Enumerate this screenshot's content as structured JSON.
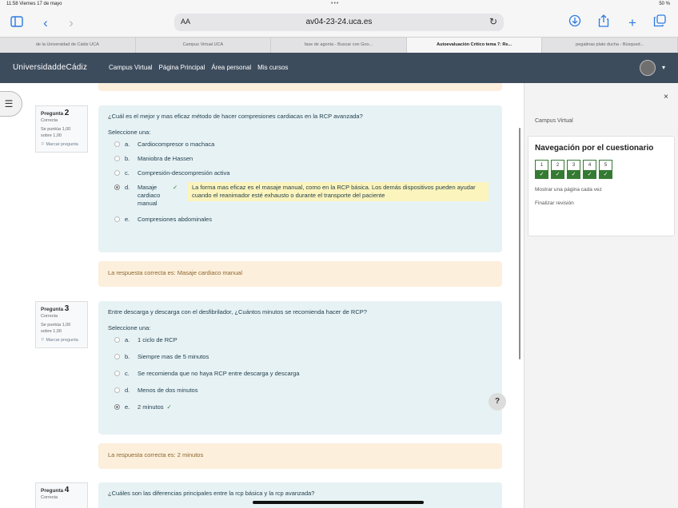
{
  "status_bar": {
    "time": "11:58  Viernes 17 de mayo",
    "dots": "•••",
    "battery": "50 %"
  },
  "browser": {
    "aa": "AA",
    "url": "av04-23-24.uca.es",
    "tabs": [
      {
        "label": "de la Universidad de Cádiz UCA",
        "active": false
      },
      {
        "label": "Campus Virtual UCA",
        "active": false
      },
      {
        "label": "fase de agonía - Buscar con Goo...",
        "active": false
      },
      {
        "label": "Autoevaluación Crítico tema 7: Re...",
        "active": true
      },
      {
        "label": "pegatinas plato ducha - Búsqued...",
        "active": false
      }
    ]
  },
  "site": {
    "brand": "UniversidaddeCádiz",
    "nav": [
      "Campus Virtual",
      "Página Principal",
      "Área personal",
      "Mis cursos"
    ]
  },
  "questions": [
    {
      "label": "Pregunta",
      "number": "2",
      "state": "Correcta",
      "score": "Se puntúa 1,00 sobre 1,00",
      "flag": "Marcar pregunta",
      "text": "¿Cuál es el mejor y mas eficaz método de hacer compresiones cardiacas en la RCP avanzada?",
      "select": "Seleccione una:",
      "options": [
        {
          "letter": "a.",
          "text": "Cardiocompresor o machaca"
        },
        {
          "letter": "b.",
          "text": "Maniobra de Hassen"
        },
        {
          "letter": "c.",
          "text": "Compresión-descompresión activa"
        },
        {
          "letter": "d.",
          "text": "Masaje cardiaco manual",
          "selected": true,
          "check": "✓",
          "feedback": "La forma mas eficaz es el masaje manual, como en la RCP básica. Los demás dispositivos pueden ayudar cuando el reanimador esté exhausto o durante el transporte del paciente"
        },
        {
          "letter": "e.",
          "text": "Compresiones abdominales"
        }
      ],
      "right_answer": "La respuesta correcta es: Masaje cardiaco manual"
    },
    {
      "label": "Pregunta",
      "number": "3",
      "state": "Correcta",
      "score": "Se puntúa 1,00 sobre 1,00",
      "flag": "Marcar pregunta",
      "text": "Entre descarga y descarga con el desfibrilador, ¿Cuántos minutos se recomienda hacer de RCP?",
      "select": "Seleccione una:",
      "options": [
        {
          "letter": "a.",
          "text": "1 ciclo de RCP"
        },
        {
          "letter": "b.",
          "text": "Siempre mas de 5 minutos"
        },
        {
          "letter": "c.",
          "text": "Se recomienda que no haya RCP entre descarga y descarga"
        },
        {
          "letter": "d.",
          "text": "Menos de dos minutos"
        },
        {
          "letter": "e.",
          "text": "2 minutos",
          "selected": true,
          "check": "✓"
        }
      ],
      "right_answer": "La respuesta correcta es: 2 minutos"
    },
    {
      "label": "Pregunta",
      "number": "4",
      "state": "Correcta",
      "text": "¿Cuáles son las diferencias principales entre la rcp básica y la rcp avanzada?"
    }
  ],
  "drawer": {
    "close": "×",
    "breadcrumb": "Campus Virtual",
    "title": "Navegación por el cuestionario",
    "quiz_nav": [
      "1",
      "2",
      "3",
      "4",
      "5"
    ],
    "check": "✓",
    "links": [
      "Mostrar una página cada vez",
      "Finalizar revisión"
    ]
  },
  "help": "?",
  "icons": [
    "sidebar-icon",
    "back-icon",
    "forward-icon",
    "reload-icon",
    "download-icon",
    "share-icon",
    "new-tab-icon",
    "tabs-icon",
    "drawer-toggle-icon",
    "close-icon",
    "help-icon"
  ]
}
